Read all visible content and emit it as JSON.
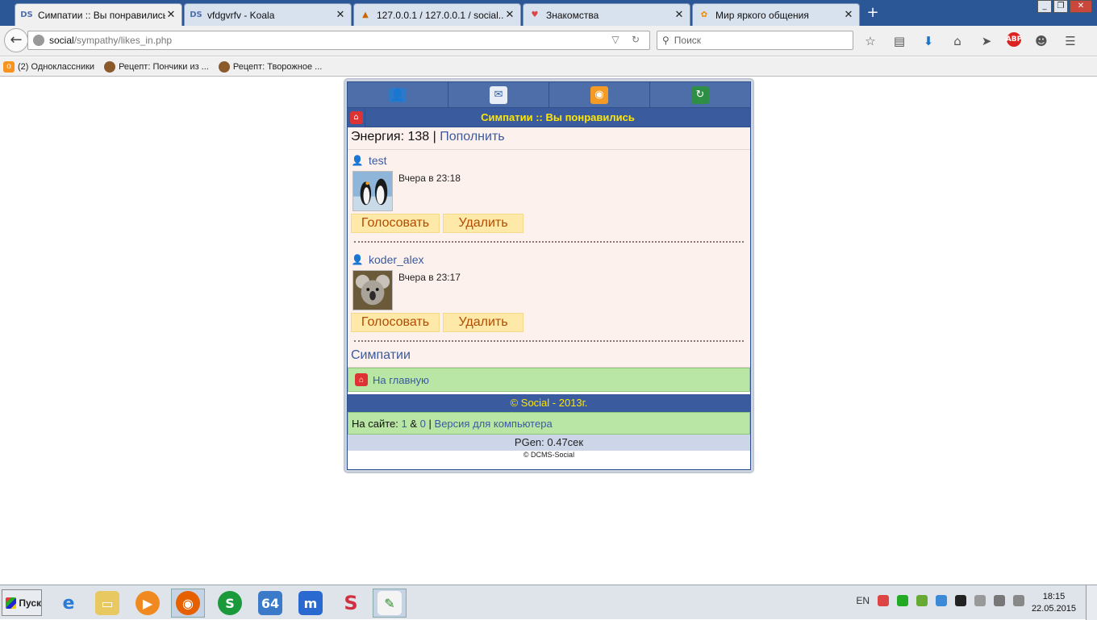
{
  "browser": {
    "tabs": [
      {
        "label": "Симпатии :: Вы понравились",
        "favicon": "DS"
      },
      {
        "label": "vfdgvrfv - Koala",
        "favicon": "DS"
      },
      {
        "label": "127.0.0.1 / 127.0.0.1 / social...",
        "favicon": "PMA"
      },
      {
        "label": "Знакомства",
        "favicon": "heart"
      },
      {
        "label": "Мир яркого общения",
        "favicon": "flower"
      }
    ],
    "url_host": "social",
    "url_path": "/sympathy/likes_in.php",
    "search_placeholder": "Поиск",
    "bookmarks": [
      {
        "label": "(2) Одноклассники",
        "icon": "ok-icon"
      },
      {
        "label": "Рецепт: Пончики из ...",
        "icon": "pot-icon"
      },
      {
        "label": "Рецепт: Творожное ...",
        "icon": "pot-icon"
      }
    ]
  },
  "page": {
    "title": "Симпатии :: Вы понравились",
    "energy_label": "Энергия: 138",
    "separator": "|",
    "refill_link": "Пополнить",
    "entries": [
      {
        "username": "test",
        "time": "Вчера в 23:18",
        "vote": "Голосовать",
        "delete": "Удалить",
        "photo": "penguins"
      },
      {
        "username": "koder_alex",
        "time": "Вчера в 23:17",
        "vote": "Голосовать",
        "delete": "Удалить",
        "photo": "koala"
      }
    ],
    "sympathy_link": "Симпатии",
    "home_link": "На главную",
    "copyright": "© Social - 2013г.",
    "online_label": "На сайте:",
    "online_users": "1",
    "online_amp": "&",
    "online_guests": "0",
    "desktop_version": "Версия для компьютера",
    "pgen": "PGen: 0.47сек",
    "engine": "© DCMS-Social"
  },
  "taskbar": {
    "start": "Пуск",
    "lang": "EN",
    "time": "18:15",
    "date": "22.05.2015"
  },
  "colors": {
    "accent_blue": "#3a5b9d",
    "title_yellow": "#ffe600",
    "green_bar": "#b9e5a5",
    "body_bg": "#fdf1ee",
    "button_bg": "#ffe9a8"
  }
}
